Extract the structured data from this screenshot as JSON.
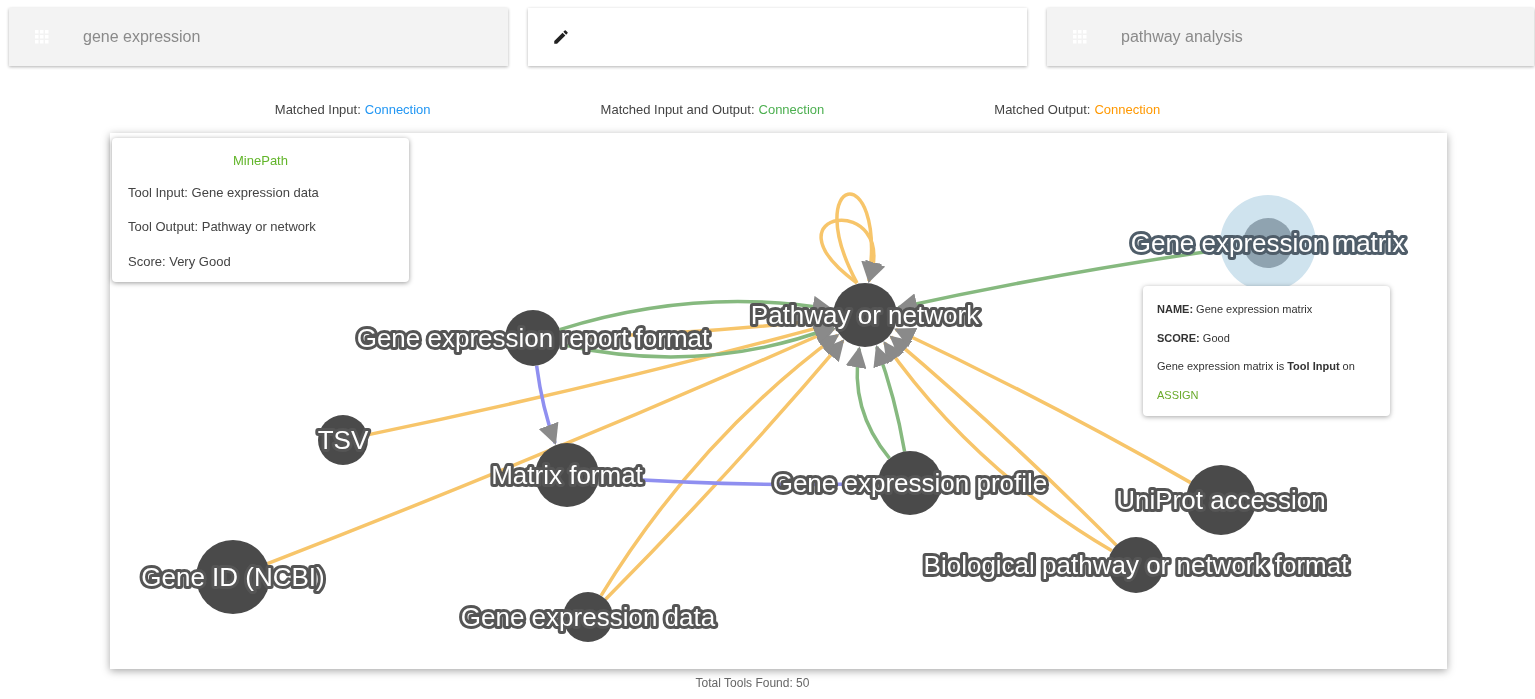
{
  "search_fields": [
    {
      "value": "gene expression",
      "kind": "tag",
      "disabled": true
    },
    {
      "kind": "edit",
      "disabled": false
    },
    {
      "value": "pathway analysis",
      "kind": "tag",
      "disabled": true
    }
  ],
  "legend": [
    {
      "label": "Matched Input:",
      "value": "Connection",
      "color": "#2196f3"
    },
    {
      "label": "Matched Input and Output:",
      "value": "Connection",
      "color": "#4caf50"
    },
    {
      "label": "Matched Output:",
      "value": "Connection",
      "color": "#ff9800"
    }
  ],
  "tool_tooltip": {
    "title": "MinePath",
    "lines": [
      "Tool Input: Gene expression data",
      "Tool Output: Pathway or network",
      "Score: Very Good"
    ]
  },
  "graph": {
    "nodes": [
      {
        "label": "Pathway or network",
        "selected": false
      },
      {
        "label": "Gene expression report format",
        "selected": false
      },
      {
        "label": "TSV",
        "selected": false
      },
      {
        "label": "Matrix format",
        "selected": false
      },
      {
        "label": "Gene expression profile",
        "selected": false
      },
      {
        "label": "UniProt accession",
        "selected": false
      },
      {
        "label": "Biological pathway or network format",
        "selected": false
      },
      {
        "label": "Gene ID (NCBI)",
        "selected": false
      },
      {
        "label": "Gene expression data",
        "selected": false
      },
      {
        "label": "Gene expression matrix",
        "selected": true
      }
    ]
  },
  "node_tooltip": {
    "lines": [
      "**NAME:** Gene expression matrix",
      "**SCORE:** Good",
      "Gene expression matrix is **Tool Input** on"
    ],
    "action": "ASSIGN"
  },
  "total": "Total Tools Found: 50"
}
